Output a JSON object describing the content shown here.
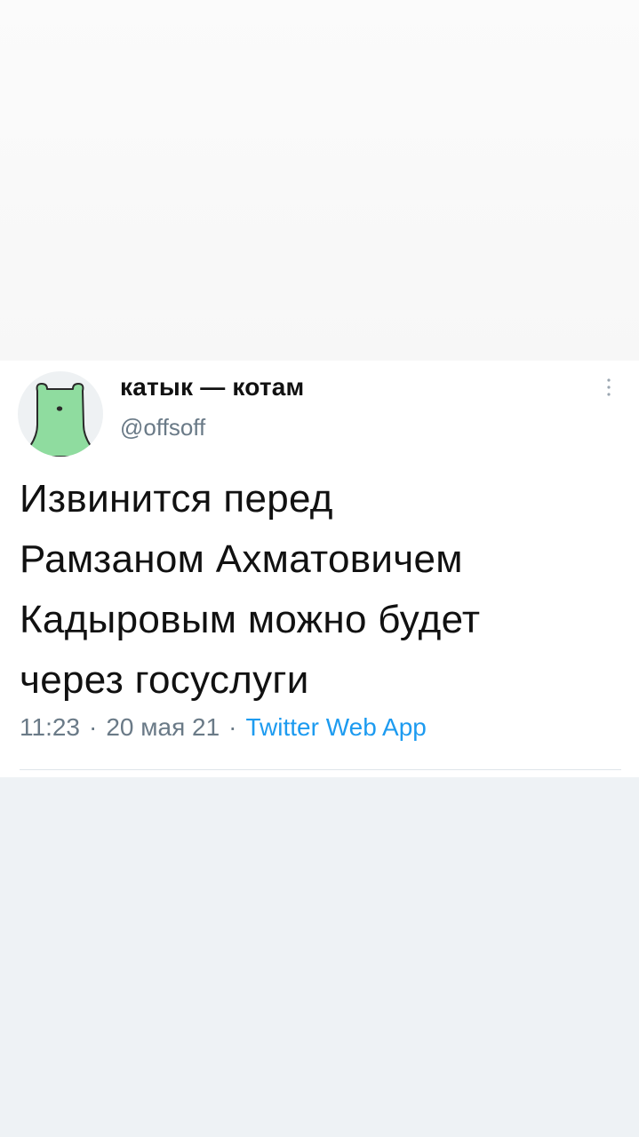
{
  "tweet": {
    "display_name": "катык — котам",
    "handle": "@offsoff",
    "text": "Извинится перед\nРамзаном Ахматовичем\nКадыровым можно будет\nчерез госуслуги",
    "time": "11:23",
    "date": "20 мая 21",
    "separator": "·",
    "source": "Twitter Web App",
    "more_icon": "vertical-dots-icon",
    "avatar_icon": "polar-bear-avatar"
  },
  "colors": {
    "avatar_fill": "#8fdc9f",
    "link": "#1d9bf0",
    "secondary_text": "#6a7a87",
    "card_bg": "#ffffff",
    "bottom_bg": "#eef2f5"
  }
}
